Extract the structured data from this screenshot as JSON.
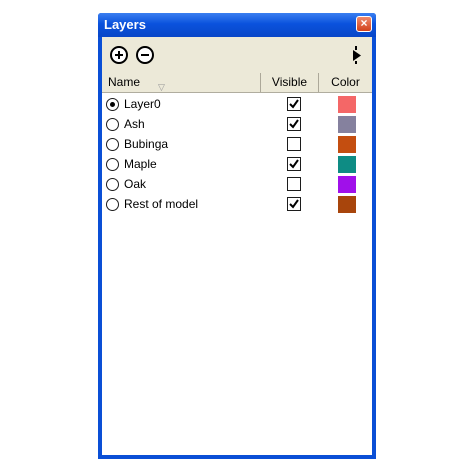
{
  "window": {
    "title": "Layers",
    "close_glyph": "×"
  },
  "toolbar": {
    "add_icon": "add-layer-icon",
    "remove_icon": "remove-layer-icon",
    "details_icon": "details-arrow-icon"
  },
  "columns": {
    "name": "Name",
    "sort_glyph": "▽",
    "visible": "Visible",
    "color": "Color"
  },
  "layers": [
    {
      "name": "Layer0",
      "active": true,
      "visible": true,
      "color": "#f46767"
    },
    {
      "name": "Ash",
      "active": false,
      "visible": true,
      "color": "#85819e"
    },
    {
      "name": "Bubinga",
      "active": false,
      "visible": false,
      "color": "#c44e10"
    },
    {
      "name": "Maple",
      "active": false,
      "visible": true,
      "color": "#0e8c84"
    },
    {
      "name": "Oak",
      "active": false,
      "visible": false,
      "color": "#a010ea"
    },
    {
      "name": "Rest of model",
      "active": false,
      "visible": true,
      "color": "#a8450c"
    }
  ]
}
